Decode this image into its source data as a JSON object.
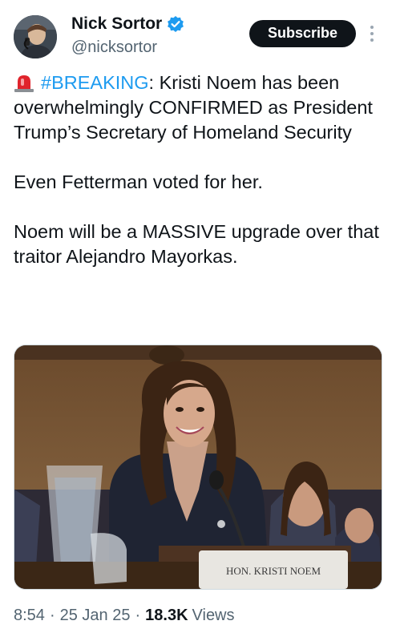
{
  "author": {
    "name": "Nick Sortor",
    "handle": "@nicksortor",
    "verified": true
  },
  "actions": {
    "subscribe_label": "Subscribe"
  },
  "tweet": {
    "siren_icon": "police-car-light-emoji",
    "hashtag": "#BREAKING",
    "line1_rest": ": Kristi Noem has been overwhelmingly CONFIRMED as President Trump’s Secretary of Homeland Security",
    "line2": "Even Fetterman voted for her.",
    "line3": "Noem will be a MASSIVE upgrade over that traitor Alejandro Mayorkas."
  },
  "media": {
    "nameplate": "HON. KRISTI NOEM"
  },
  "meta": {
    "time": "8:54",
    "date": "25 Jan 25",
    "views_count": "18.3K",
    "views_label": "Views"
  },
  "colors": {
    "link": "#1d9bf0",
    "text": "#0f1419",
    "muted": "#536471",
    "button_bg": "#0f1419"
  }
}
